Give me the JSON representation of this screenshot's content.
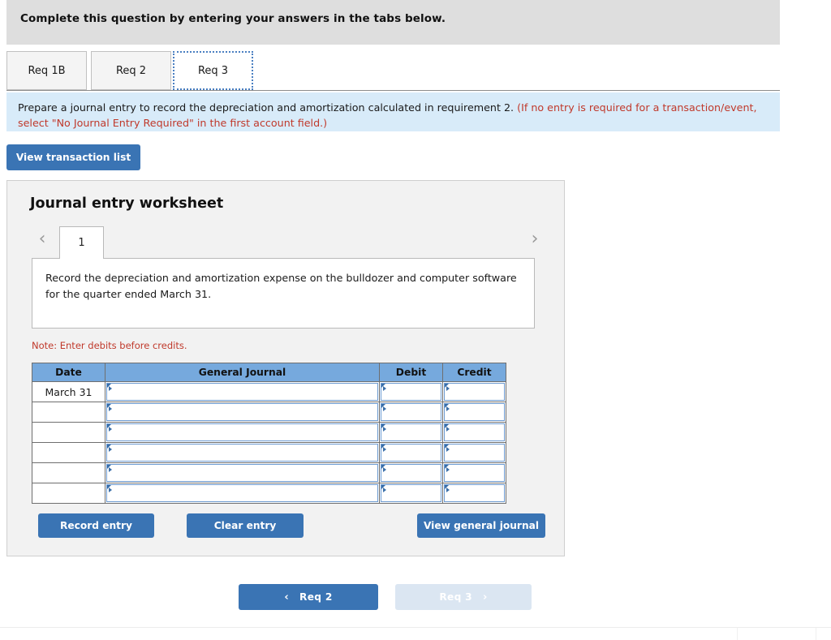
{
  "banner": {
    "text": "Complete this question by entering your answers in the tabs below."
  },
  "tabs": [
    {
      "label": "Req 1B",
      "active": false
    },
    {
      "label": "Req 2",
      "active": false
    },
    {
      "label": "Req 3",
      "active": true
    }
  ],
  "instructions": {
    "main": "Prepare a journal entry to record the depreciation and amortization calculated in requirement 2. ",
    "hint": "(If no entry is required for a transaction/event, select \"No Journal Entry Required\" in the first account field.)"
  },
  "toolbar": {
    "view_transaction_list_label": "View transaction list"
  },
  "worksheet": {
    "title": "Journal entry worksheet",
    "prev_arrow": "‹",
    "next_arrow": "›",
    "page_number": "1",
    "description": "Record the depreciation and amortization expense on the bulldozer and computer software for the quarter ended March 31.",
    "note": "Note: Enter debits before credits.",
    "table": {
      "headers": [
        "Date",
        "General Journal",
        "Debit",
        "Credit"
      ],
      "rows": [
        {
          "date": "March 31",
          "general_journal": "",
          "debit": "",
          "credit": ""
        },
        {
          "date": "",
          "general_journal": "",
          "debit": "",
          "credit": ""
        },
        {
          "date": "",
          "general_journal": "",
          "debit": "",
          "credit": ""
        },
        {
          "date": "",
          "general_journal": "",
          "debit": "",
          "credit": ""
        },
        {
          "date": "",
          "general_journal": "",
          "debit": "",
          "credit": ""
        },
        {
          "date": "",
          "general_journal": "",
          "debit": "",
          "credit": ""
        }
      ]
    },
    "actions": {
      "record_entry_label": "Record entry",
      "clear_entry_label": "Clear entry",
      "view_general_journal_label": "View general journal"
    }
  },
  "bottom_nav": {
    "prev_chevron": "‹",
    "prev_label": "Req 2",
    "next_label": "Req 3",
    "next_chevron": "›",
    "next_disabled": true
  },
  "colors": {
    "banner_bg": "#dedede",
    "instruction_bg": "#d8ebf9",
    "accent_blue": "#3a74b4",
    "table_header_blue": "#76a9dd",
    "red_text": "#c0392b",
    "disabled_button": "#dbe6f2"
  }
}
